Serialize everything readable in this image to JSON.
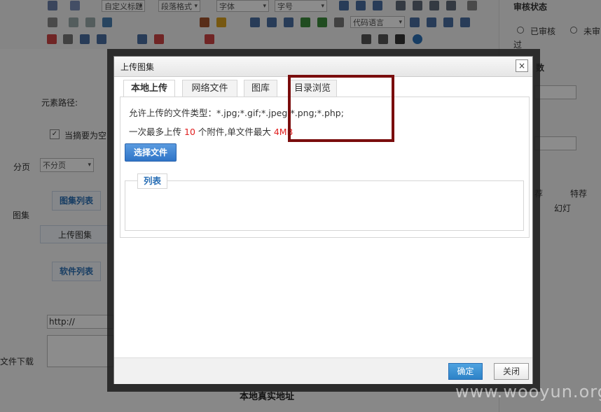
{
  "editor": {
    "toolbar_selects": [
      "自定义标题",
      "段落格式",
      "字体",
      "字号",
      "代码语言"
    ]
  },
  "form": {
    "element_path_label": "元素路径:",
    "checkbox_label": "当摘要为空",
    "paging_label": "分页",
    "paging_value": "不分页",
    "gallery_label": "图集",
    "gallery_list_button": "图集列表",
    "upload_gallery_button": "上传图集",
    "software_list_button": "软件列表",
    "url_value": "http://",
    "file_download_label": "文件下载",
    "local_real_address": "本地真实地址"
  },
  "right_panel": {
    "review_status_title": "审核状态",
    "approved_label": "已审核",
    "not_approved_label": "未审",
    "passed_label": "过",
    "count_label": "数",
    "recommend_label": "荐",
    "special_recommend_label": "特荐",
    "slideshow_label": "幻灯"
  },
  "dialog": {
    "title": "上传图集",
    "close_glyph": "×",
    "tabs": [
      "本地上传",
      "网络文件",
      "图库",
      "目录浏览"
    ],
    "allowed_types_label": "允许上传的文件类型：",
    "allowed_types_value": "*.jpg;*.gif;*.jpeg;*.png;*.php;",
    "limit_prefix": "一次最多上传",
    "limit_count": "10",
    "limit_middle": "个附件,单文件最大",
    "limit_size": "4MB",
    "select_file_button": "选择文件",
    "list_legend": "列表",
    "ok_button": "确定",
    "close_button": "关闭"
  },
  "watermark": "www.wooyun.org",
  "colors": {
    "highlight_box": "#7a0d0d",
    "ok_button": "#2d82c7",
    "select_file_button": "#2f74c7",
    "limit_text_red": "#e02020"
  }
}
